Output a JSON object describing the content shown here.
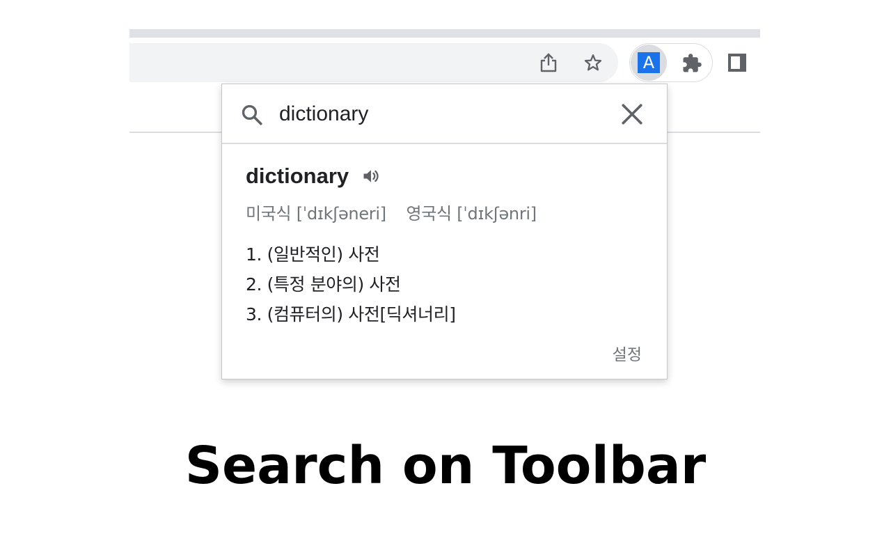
{
  "browser": {
    "toolbar": {
      "share_icon": "share-icon",
      "bookmark_icon": "star-icon",
      "extensions": [
        {
          "name": "translate-extension",
          "badge_label": "A",
          "color": "#1a73e8",
          "active": true
        },
        {
          "name": "extensions-menu",
          "icon": "puzzle-icon"
        }
      ],
      "side_panel_icon": "side-panel-icon"
    }
  },
  "popup": {
    "search": {
      "icon": "search-icon",
      "value": "dictionary",
      "clear_icon": "close-icon"
    },
    "entry": {
      "headword": "dictionary",
      "audio_icon": "speaker-icon",
      "pronunciations": [
        {
          "label": "미국식",
          "ipa": "[ˈdɪkʃəneri]"
        },
        {
          "label": "영국식",
          "ipa": "[ˈdɪkʃənri]"
        }
      ],
      "definitions": [
        "1. (일반적인) 사전",
        "2. (특정 분야의) 사전",
        "3. (컴퓨터의) 사전[딕셔너리]"
      ]
    },
    "settings_label": "설정"
  },
  "caption": "Search on Toolbar",
  "colors": {
    "accent": "#1a73e8",
    "icon_gray": "#5f6368",
    "text": "#202124",
    "secondary_text": "#70757a"
  }
}
